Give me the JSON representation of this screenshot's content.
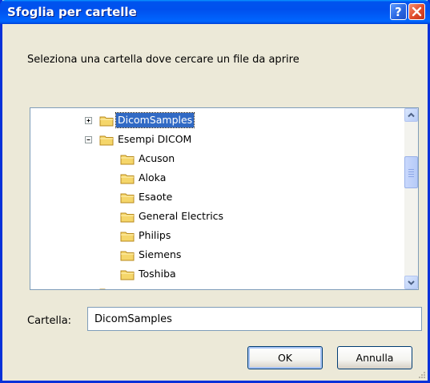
{
  "window": {
    "title": "Sfoglia per cartelle"
  },
  "instruction": "Seleziona una cartella dove cercare un file da aprire",
  "tree": {
    "items": [
      {
        "label": "DicomSamples",
        "expander": "plus",
        "selected": true
      },
      {
        "label": "Esempi DICOM",
        "expander": "minus",
        "selected": false
      },
      {
        "label": "Acuson"
      },
      {
        "label": "Aloka"
      },
      {
        "label": "Esaote"
      },
      {
        "label": "General Electrics"
      },
      {
        "label": "Philips"
      },
      {
        "label": "Siemens"
      },
      {
        "label": "Toshiba"
      }
    ]
  },
  "folder": {
    "label": "Cartella:",
    "value": "DicomSamples"
  },
  "buttons": {
    "ok": "OK",
    "cancel": "Annulla"
  },
  "colors": {
    "titlebar": "#0053ee",
    "selection": "#316ac5",
    "folder": "#f5d66a"
  },
  "icons": {
    "help": "question-mark-icon",
    "close": "close-x-icon",
    "folder": "folder-icon",
    "expand": "plus-box-icon",
    "collapse": "minus-box-icon"
  }
}
